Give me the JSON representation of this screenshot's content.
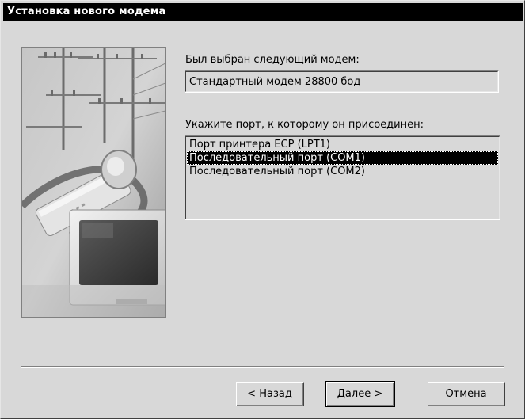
{
  "window": {
    "title": "Установка нового модема"
  },
  "modem": {
    "selected_label": "Был выбран следующий модем:",
    "name": "Стандартный модем 28800 бод"
  },
  "port": {
    "prompt": "Укажите порт, к которому он присоединен:",
    "items": [
      {
        "label": "Порт принтера ECP (LPT1)",
        "selected": false
      },
      {
        "label": "Последовательный порт (COM1)",
        "selected": true
      },
      {
        "label": "Последовательный порт (COM2)",
        "selected": false
      }
    ]
  },
  "buttons": {
    "back_prefix": "< ",
    "back_accel": "Н",
    "back_rest": "азад",
    "next_label": "Далее >",
    "cancel_label": "Отмена"
  },
  "colors": {
    "dialog_bg": "#d8d8d8",
    "titlebar_bg": "#000000",
    "selection_bg": "#000000"
  }
}
